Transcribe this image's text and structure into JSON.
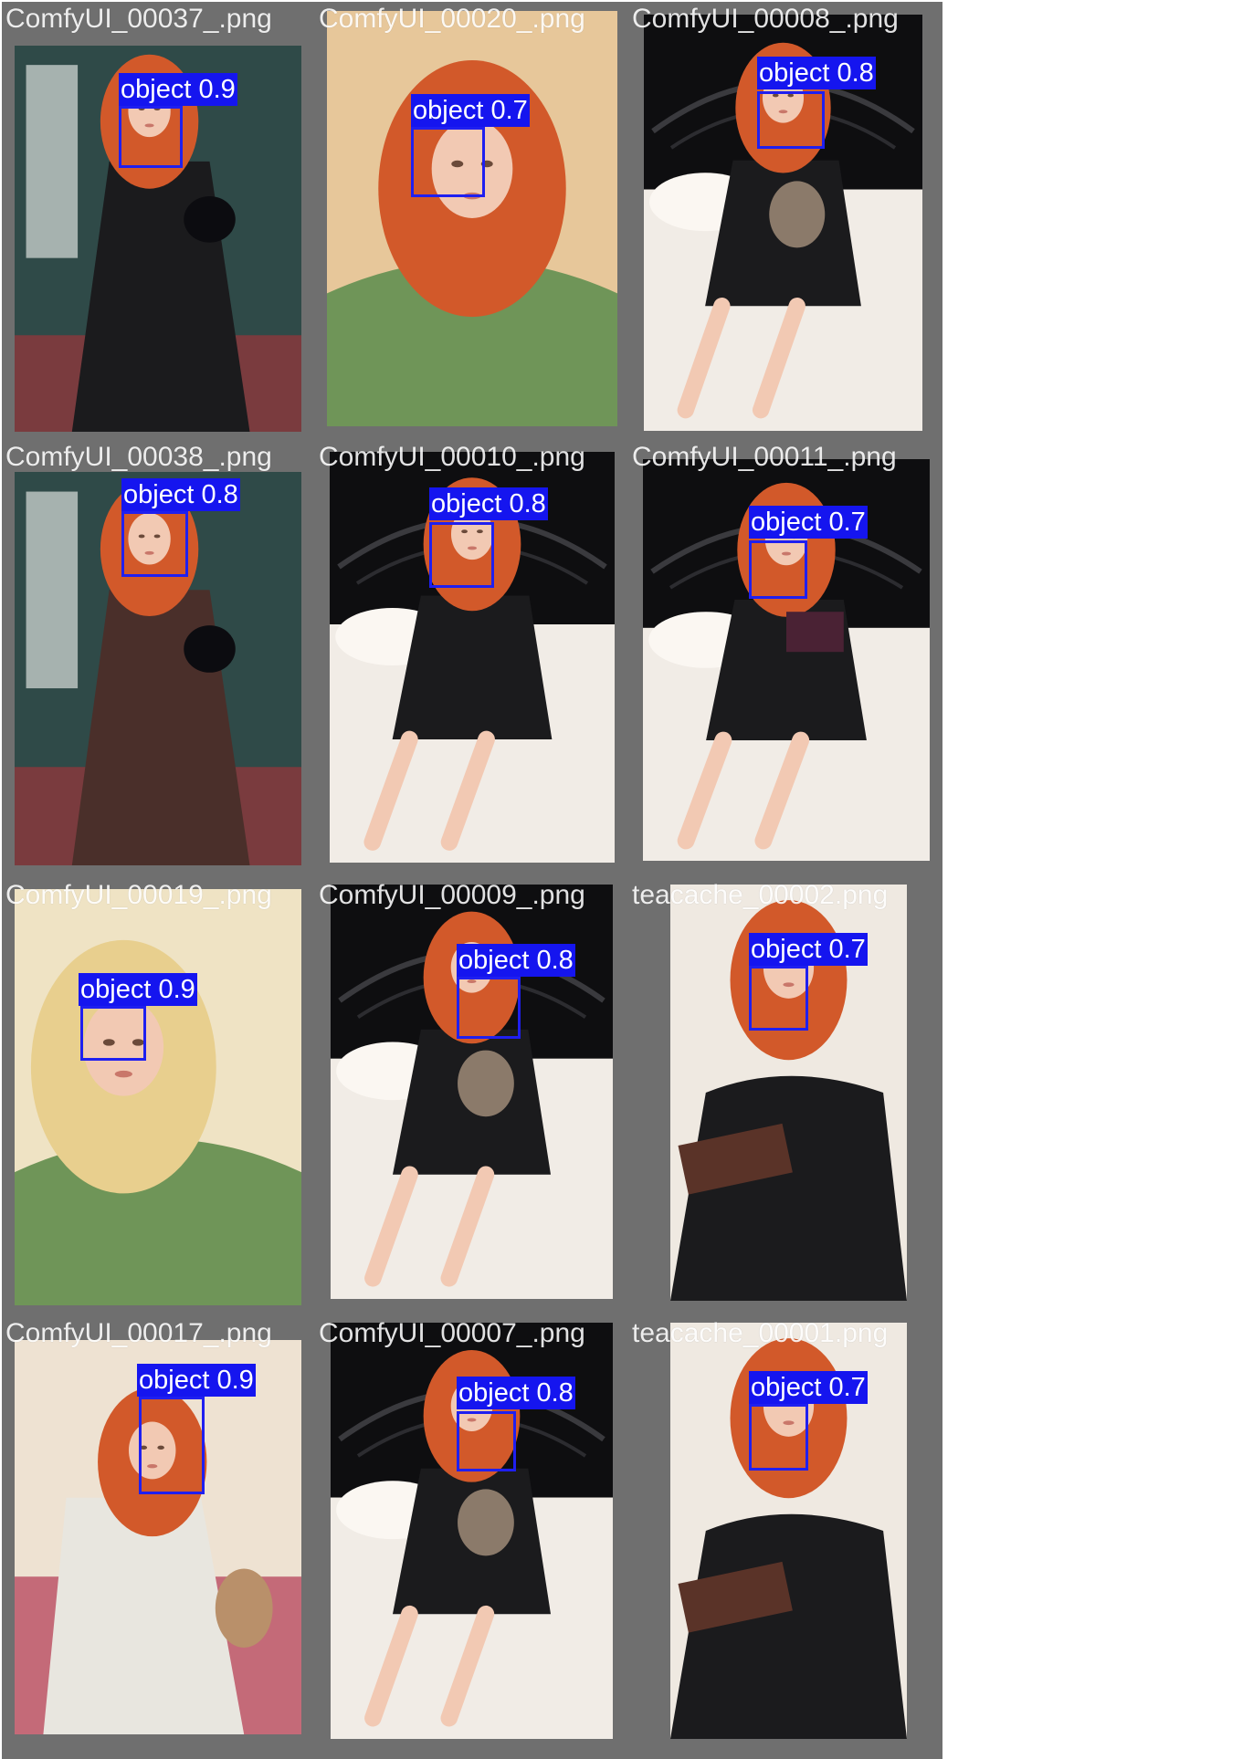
{
  "gallery": {
    "tiles": [
      {
        "filename": "ComfyUI_00037_.png",
        "label": "object 0.9"
      },
      {
        "filename": "ComfyUI_00020_.png",
        "label": "object 0.7"
      },
      {
        "filename": "ComfyUI_00008_.png",
        "label": "object 0.8"
      },
      {
        "filename": "ComfyUI_00038_.png",
        "label": "object 0.8"
      },
      {
        "filename": "ComfyUI_00010_.png",
        "label": "object 0.8"
      },
      {
        "filename": "ComfyUI_00011_.png",
        "label": "object 0.7"
      },
      {
        "filename": "ComfyUI_00019_.png",
        "label": "object 0.9"
      },
      {
        "filename": "ComfyUI_00009_.png",
        "label": "object 0.8"
      },
      {
        "filename": "teacache_00002.png",
        "label": "object 0.7"
      },
      {
        "filename": "ComfyUI_00017_.png",
        "label": "object 0.9"
      },
      {
        "filename": "ComfyUI_00007_.png",
        "label": "object 0.8"
      },
      {
        "filename": "teacache_00001.png",
        "label": "object 0.7"
      }
    ]
  },
  "colors": {
    "tile_background": "#6f6f6f",
    "detection_box": "#1f1ff0",
    "detection_label_bg": "#1515ef",
    "hair": "#d2592a",
    "hair_blonde": "#e8cf8e",
    "skin": "#f2c9b3",
    "dress_black": "#1b1b1d",
    "sweater_green": "#6f9558",
    "bedsheet": "#f1ece6"
  }
}
